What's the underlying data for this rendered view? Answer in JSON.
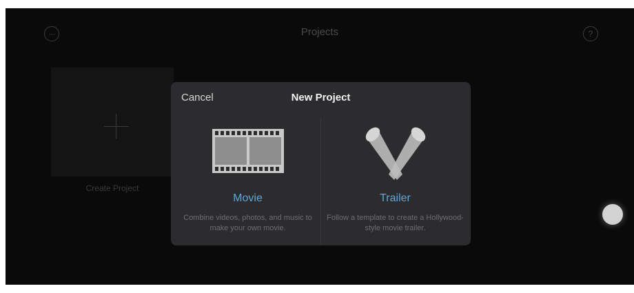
{
  "header": {
    "title": "Projects",
    "more_icon": "ellipsis-icon",
    "help_icon": "question-mark-icon"
  },
  "create_tile": {
    "label": "Create Project",
    "icon": "plus-icon"
  },
  "modal": {
    "cancel_label": "Cancel",
    "title": "New Project",
    "options": [
      {
        "label": "Movie",
        "description": "Combine videos, photos, and music to make your own movie.",
        "icon": "film-strip-icon"
      },
      {
        "label": "Trailer",
        "description": "Follow a template to create a Hollywood-style movie trailer.",
        "icon": "spotlight-icon"
      }
    ]
  },
  "colors": {
    "accent": "#5ea8dc",
    "modal_bg": "#2c2c2e",
    "background": "#0a0a0a"
  }
}
